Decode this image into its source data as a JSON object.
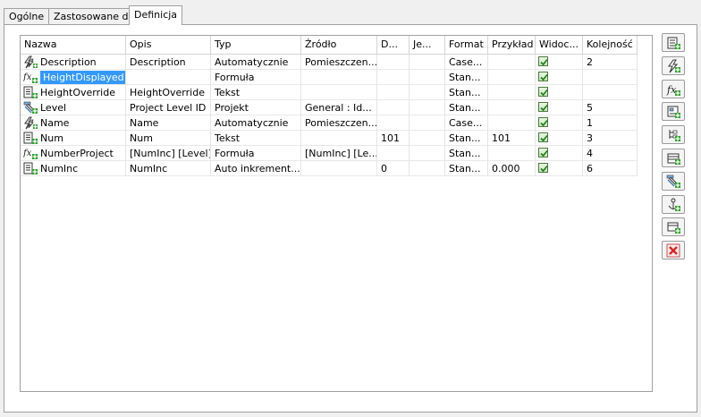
{
  "tabs": [
    "Ogólne",
    "Zastosowane do",
    "Definicja"
  ],
  "active_tab": 2,
  "columns": [
    "Nazwa",
    "Opis",
    "Typ",
    "Źródło",
    "D...",
    "Je...",
    "Format",
    "Przykład",
    "Widoc...",
    "Kolejność"
  ],
  "rows": [
    {
      "icon": "lightning-icon",
      "name": "Description",
      "opis": "Description",
      "typ": "Automatycznie",
      "zrodlo": "Pomieszczen...",
      "d": "",
      "je": "",
      "format": "Case...",
      "przyklad": "",
      "widoczny": true,
      "kolejnosc": "2"
    },
    {
      "icon": "formula-icon",
      "name": "HeightDisplayed",
      "selected": true,
      "opis": "",
      "typ": "Formuła",
      "zrodlo": "",
      "d": "",
      "je": "",
      "format": "Stan...",
      "przyklad": "",
      "widoczny": true,
      "kolejnosc": ""
    },
    {
      "icon": "text-param-icon",
      "name": "HeightOverride",
      "opis": "HeightOverride",
      "typ": "Tekst",
      "zrodlo": "",
      "d": "",
      "je": "",
      "format": "Stan...",
      "przyklad": "",
      "widoczny": true,
      "kolejnosc": ""
    },
    {
      "icon": "project-icon",
      "name": "Level",
      "opis": "Project Level ID",
      "typ": "Projekt",
      "zrodlo": "General : Id...",
      "d": "",
      "je": "",
      "format": "Stan...",
      "przyklad": "",
      "widoczny": true,
      "kolejnosc": "5"
    },
    {
      "icon": "lightning-icon",
      "name": "Name",
      "opis": "Name",
      "typ": "Automatycznie",
      "zrodlo": "Pomieszczen...",
      "d": "",
      "je": "",
      "format": "Case...",
      "przyklad": "",
      "widoczny": true,
      "kolejnosc": "1"
    },
    {
      "icon": "text-param-icon",
      "name": "Num",
      "opis": "Num",
      "typ": "Tekst",
      "zrodlo": "",
      "d": "101",
      "je": "",
      "format": "Stan...",
      "przyklad": "101",
      "widoczny": true,
      "kolejnosc": "3"
    },
    {
      "icon": "formula-icon",
      "name": "NumberProject",
      "opis": "[NumInc] [Level]",
      "typ": "Formuła",
      "zrodlo": "[NumInc] [Le...",
      "d": "",
      "je": "",
      "format": "Stan...",
      "przyklad": "",
      "widoczny": true,
      "kolejnosc": "4"
    },
    {
      "icon": "text-param-icon",
      "name": "NumInc",
      "opis": "NumInc",
      "typ": "Auto inkrement...",
      "zrodlo": "",
      "d": "0",
      "je": "",
      "format": "Stan...",
      "przyklad": "0.000",
      "widoczny": true,
      "kolejnosc": "6"
    }
  ],
  "toolbar": [
    "add-text-param-icon",
    "add-auto-param-icon",
    "add-formula-param-icon",
    "add-lookup-param-icon",
    "add-tree-param-icon",
    "add-table-param-icon",
    "add-project-param-icon",
    "add-anchor-param-icon",
    "add-window-param-icon",
    "delete-icon"
  ]
}
